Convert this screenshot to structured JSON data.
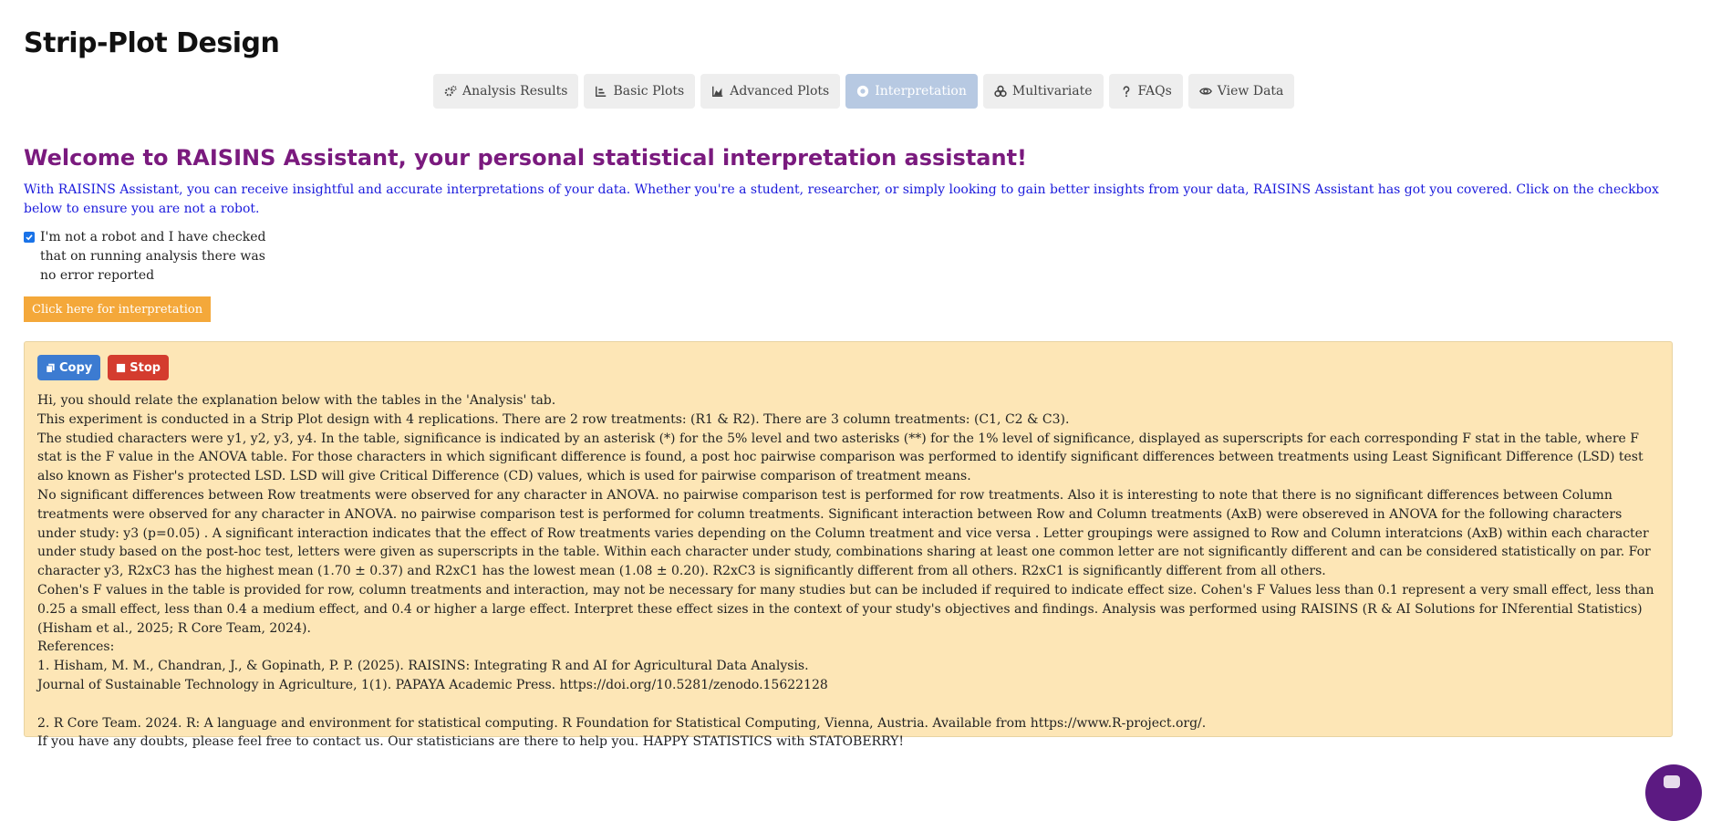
{
  "page": {
    "title": "Strip-Plot Design"
  },
  "tabs": [
    {
      "label": "Analysis Results",
      "icon": "cogs-icon",
      "active": false
    },
    {
      "label": "Basic Plots",
      "icon": "bar-chart-icon",
      "active": false
    },
    {
      "label": "Advanced Plots",
      "icon": "area-chart-icon",
      "active": false
    },
    {
      "label": "Interpretation",
      "icon": "robot-icon",
      "active": true
    },
    {
      "label": "Multivariate",
      "icon": "circles-icon",
      "active": false
    },
    {
      "label": "FAQs",
      "icon": "question-icon",
      "active": false
    },
    {
      "label": "View Data",
      "icon": "eye-icon",
      "active": false
    }
  ],
  "assistant": {
    "welcome": "Welcome to RAISINS Assistant, your personal statistical interpretation assistant!",
    "intro": "With RAISINS Assistant, you can receive insightful and accurate interpretations of your data. Whether you're a student, researcher, or simply looking to gain better insights from your data, RAISINS Assistant has got you covered. Click on the checkbox below to ensure you are not a robot.",
    "robot_check_label": "I'm not a robot and I have checked that on running analysis there was no error reported",
    "robot_checked": true,
    "interpret_button": "Click here for interpretation"
  },
  "result": {
    "copy_label": "Copy",
    "stop_label": "Stop",
    "lines": [
      "Hi, you should relate the explanation below with the tables in the 'Analysis' tab.",
      "This experiment is conducted in a Strip Plot design with 4 replications. There are 2 row treatments: (R1 & R2). There are 3 column treatments: (C1, C2 & C3).",
      "The studied characters were y1, y2, y3, y4. In the table, significance is indicated by an asterisk (*) for the 5% level and two asterisks (**) for the 1% level of significance, displayed as superscripts for each corresponding F stat in the table, where F stat is the F value in the ANOVA table. For those characters in which significant difference is found, a post hoc pairwise comparison was performed to identify significant differences between treatments using Least Significant Difference (LSD) test also known as Fisher's protected LSD. LSD will give Critical Difference (CD) values, which is used for pairwise comparison of treatment means.",
      "No significant differences between Row treatments were observed for any character in ANOVA. no pairwise comparison test is performed for row treatments. Also it is interesting to note that there is no significant differences between Column treatments were observed for any character in ANOVA. no pairwise comparison test is performed for column treatments. Significant interaction between Row and Column treatments (AxB) were obsereved in ANOVA for the following characters under study: y3 (p=0.05) . A significant interaction indicates that the effect of Row treatments varies depending on the Column treatment and vice versa . Letter groupings were assigned to Row and Column interatcions (AxB) within each character under study based on the post-hoc test, letters were given as superscripts in the table. Within each character under study, combinations sharing at least one common letter are not significantly different and can be considered statistically on par. For character y3, R2xC3 has the highest mean (1.70 ± 0.37) and R2xC1 has the lowest mean (1.08 ± 0.20). R2xC3 is significantly different from all others. R2xC1 is significantly different from all others.",
      "Cohen's F values in the table is provided for row, column treatments and interaction, may not be necessary for many studies but can be included if required to indicate effect size. Cohen's F Values less than 0.1 represent a very small effect, less than 0.25 a small effect, less than 0.4 a medium effect, and 0.4 or higher a large effect. Interpret these effect sizes in the context of your study's objectives and findings. Analysis was performed using RAISINS (R & AI Solutions for INferential Statistics) (Hisham et al., 2025; R Core Team, 2024).",
      "References:",
      "1. Hisham, M. M., Chandran, J., & Gopinath, P. P. (2025). RAISINS: Integrating R and AI for Agricultural Data Analysis.",
      "Journal of Sustainable Technology in Agriculture, 1(1). PAPAYA Academic Press. https://doi.org/10.5281/zenodo.15622128",
      "",
      "2. R Core Team. 2024. R: A language and environment for statistical computing. R Foundation for Statistical Computing, Vienna, Austria. Available from https://www.R-project.org/.",
      "If you have any doubts, please feel free to contact us. Our statisticians are there to help you. HAPPY STATISTICS with STATOBERRY!"
    ]
  }
}
